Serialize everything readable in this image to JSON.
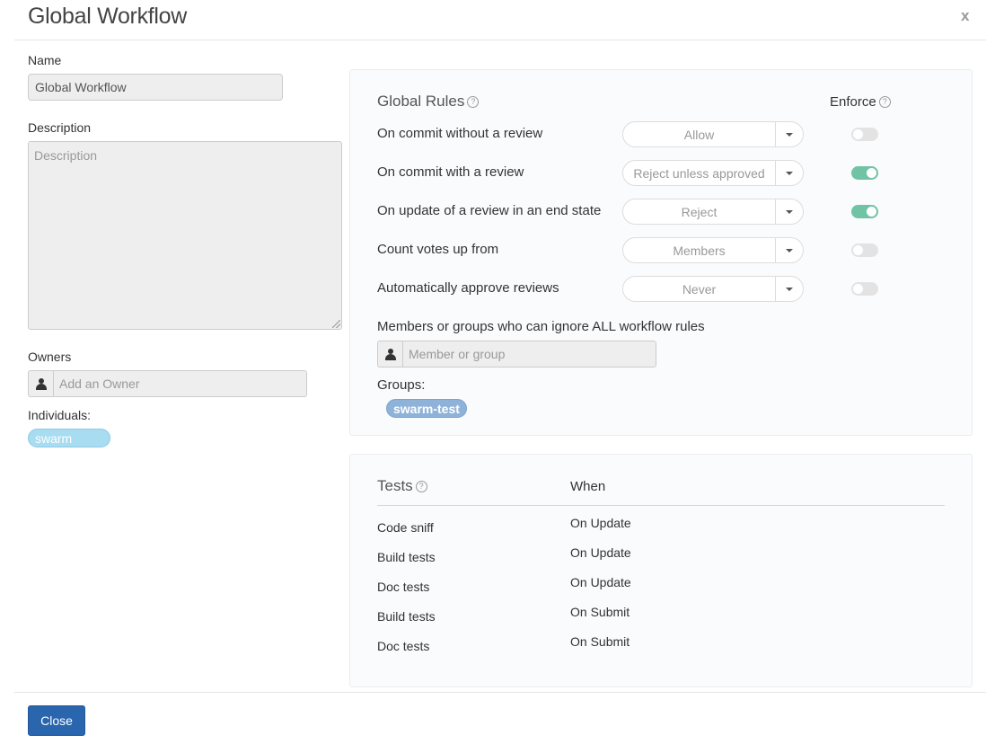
{
  "modal": {
    "title": "Global Workflow",
    "close_glyph": "x"
  },
  "left": {
    "name_label": "Name",
    "name_value": "Global Workflow",
    "description_label": "Description",
    "description_placeholder": "Description",
    "owners_label": "Owners",
    "owner_placeholder": "Add an Owner",
    "individuals_label": "Individuals:",
    "individuals": [
      "swarm"
    ]
  },
  "rules": {
    "title": "Global Rules",
    "enforce_label": "Enforce",
    "items": [
      {
        "label": "On commit without a review",
        "value": "Allow",
        "enforced": false
      },
      {
        "label": "On commit with a review",
        "value": "Reject unless approved",
        "enforced": true
      },
      {
        "label": "On update of a review in an end state",
        "value": "Reject",
        "enforced": true
      },
      {
        "label": "Count votes up from",
        "value": "Members",
        "enforced": false
      },
      {
        "label": "Automatically approve reviews",
        "value": "Never",
        "enforced": false
      }
    ],
    "ignore_label": "Members or groups who can ignore ALL workflow rules",
    "ignore_placeholder": "Member or group",
    "groups_label": "Groups:",
    "groups": [
      "swarm-test"
    ]
  },
  "tests": {
    "title": "Tests",
    "when_header": "When",
    "rows": [
      {
        "name": "Code sniff",
        "when": "On Update"
      },
      {
        "name": "Build tests",
        "when": "On Update"
      },
      {
        "name": "Doc tests",
        "when": "On Update"
      },
      {
        "name": "Build tests",
        "when": "On Submit"
      },
      {
        "name": "Doc tests",
        "when": "On Submit"
      }
    ]
  },
  "footer": {
    "close_label": "Close"
  },
  "colors": {
    "primary": "#2a66ad",
    "toggle_on": "#70c3a5",
    "toggle_off": "#e3e3e3",
    "pill_individual": "#a8dcf0",
    "pill_group": "#8fb2d9"
  },
  "icons": {
    "owner": "person-icon",
    "member": "person-icon",
    "help": "question-circle-icon",
    "dropdown": "caret-down-icon",
    "close": "close-icon"
  }
}
